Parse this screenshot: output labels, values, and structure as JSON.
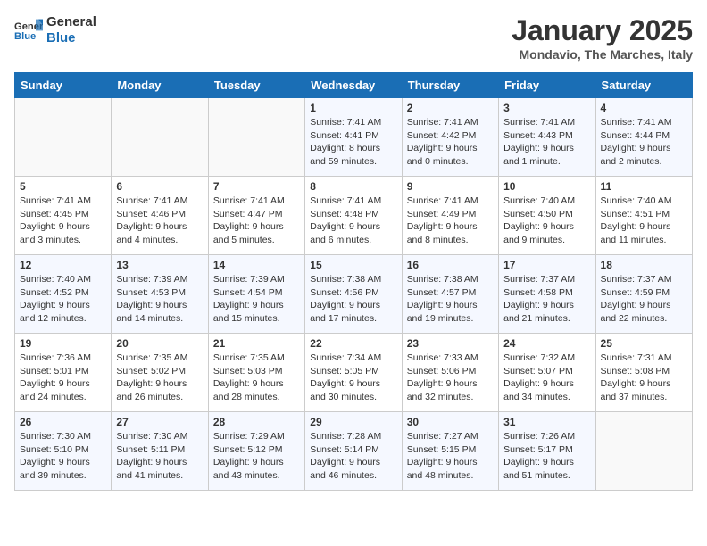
{
  "logo": {
    "line1": "General",
    "line2": "Blue"
  },
  "title": "January 2025",
  "subtitle": "Mondavio, The Marches, Italy",
  "days_of_week": [
    "Sunday",
    "Monday",
    "Tuesday",
    "Wednesday",
    "Thursday",
    "Friday",
    "Saturday"
  ],
  "weeks": [
    [
      {
        "day": "",
        "info": ""
      },
      {
        "day": "",
        "info": ""
      },
      {
        "day": "",
        "info": ""
      },
      {
        "day": "1",
        "info": "Sunrise: 7:41 AM\nSunset: 4:41 PM\nDaylight: 8 hours and 59 minutes."
      },
      {
        "day": "2",
        "info": "Sunrise: 7:41 AM\nSunset: 4:42 PM\nDaylight: 9 hours and 0 minutes."
      },
      {
        "day": "3",
        "info": "Sunrise: 7:41 AM\nSunset: 4:43 PM\nDaylight: 9 hours and 1 minute."
      },
      {
        "day": "4",
        "info": "Sunrise: 7:41 AM\nSunset: 4:44 PM\nDaylight: 9 hours and 2 minutes."
      }
    ],
    [
      {
        "day": "5",
        "info": "Sunrise: 7:41 AM\nSunset: 4:45 PM\nDaylight: 9 hours and 3 minutes."
      },
      {
        "day": "6",
        "info": "Sunrise: 7:41 AM\nSunset: 4:46 PM\nDaylight: 9 hours and 4 minutes."
      },
      {
        "day": "7",
        "info": "Sunrise: 7:41 AM\nSunset: 4:47 PM\nDaylight: 9 hours and 5 minutes."
      },
      {
        "day": "8",
        "info": "Sunrise: 7:41 AM\nSunset: 4:48 PM\nDaylight: 9 hours and 6 minutes."
      },
      {
        "day": "9",
        "info": "Sunrise: 7:41 AM\nSunset: 4:49 PM\nDaylight: 9 hours and 8 minutes."
      },
      {
        "day": "10",
        "info": "Sunrise: 7:40 AM\nSunset: 4:50 PM\nDaylight: 9 hours and 9 minutes."
      },
      {
        "day": "11",
        "info": "Sunrise: 7:40 AM\nSunset: 4:51 PM\nDaylight: 9 hours and 11 minutes."
      }
    ],
    [
      {
        "day": "12",
        "info": "Sunrise: 7:40 AM\nSunset: 4:52 PM\nDaylight: 9 hours and 12 minutes."
      },
      {
        "day": "13",
        "info": "Sunrise: 7:39 AM\nSunset: 4:53 PM\nDaylight: 9 hours and 14 minutes."
      },
      {
        "day": "14",
        "info": "Sunrise: 7:39 AM\nSunset: 4:54 PM\nDaylight: 9 hours and 15 minutes."
      },
      {
        "day": "15",
        "info": "Sunrise: 7:38 AM\nSunset: 4:56 PM\nDaylight: 9 hours and 17 minutes."
      },
      {
        "day": "16",
        "info": "Sunrise: 7:38 AM\nSunset: 4:57 PM\nDaylight: 9 hours and 19 minutes."
      },
      {
        "day": "17",
        "info": "Sunrise: 7:37 AM\nSunset: 4:58 PM\nDaylight: 9 hours and 21 minutes."
      },
      {
        "day": "18",
        "info": "Sunrise: 7:37 AM\nSunset: 4:59 PM\nDaylight: 9 hours and 22 minutes."
      }
    ],
    [
      {
        "day": "19",
        "info": "Sunrise: 7:36 AM\nSunset: 5:01 PM\nDaylight: 9 hours and 24 minutes."
      },
      {
        "day": "20",
        "info": "Sunrise: 7:35 AM\nSunset: 5:02 PM\nDaylight: 9 hours and 26 minutes."
      },
      {
        "day": "21",
        "info": "Sunrise: 7:35 AM\nSunset: 5:03 PM\nDaylight: 9 hours and 28 minutes."
      },
      {
        "day": "22",
        "info": "Sunrise: 7:34 AM\nSunset: 5:05 PM\nDaylight: 9 hours and 30 minutes."
      },
      {
        "day": "23",
        "info": "Sunrise: 7:33 AM\nSunset: 5:06 PM\nDaylight: 9 hours and 32 minutes."
      },
      {
        "day": "24",
        "info": "Sunrise: 7:32 AM\nSunset: 5:07 PM\nDaylight: 9 hours and 34 minutes."
      },
      {
        "day": "25",
        "info": "Sunrise: 7:31 AM\nSunset: 5:08 PM\nDaylight: 9 hours and 37 minutes."
      }
    ],
    [
      {
        "day": "26",
        "info": "Sunrise: 7:30 AM\nSunset: 5:10 PM\nDaylight: 9 hours and 39 minutes."
      },
      {
        "day": "27",
        "info": "Sunrise: 7:30 AM\nSunset: 5:11 PM\nDaylight: 9 hours and 41 minutes."
      },
      {
        "day": "28",
        "info": "Sunrise: 7:29 AM\nSunset: 5:12 PM\nDaylight: 9 hours and 43 minutes."
      },
      {
        "day": "29",
        "info": "Sunrise: 7:28 AM\nSunset: 5:14 PM\nDaylight: 9 hours and 46 minutes."
      },
      {
        "day": "30",
        "info": "Sunrise: 7:27 AM\nSunset: 5:15 PM\nDaylight: 9 hours and 48 minutes."
      },
      {
        "day": "31",
        "info": "Sunrise: 7:26 AM\nSunset: 5:17 PM\nDaylight: 9 hours and 51 minutes."
      },
      {
        "day": "",
        "info": ""
      }
    ]
  ]
}
